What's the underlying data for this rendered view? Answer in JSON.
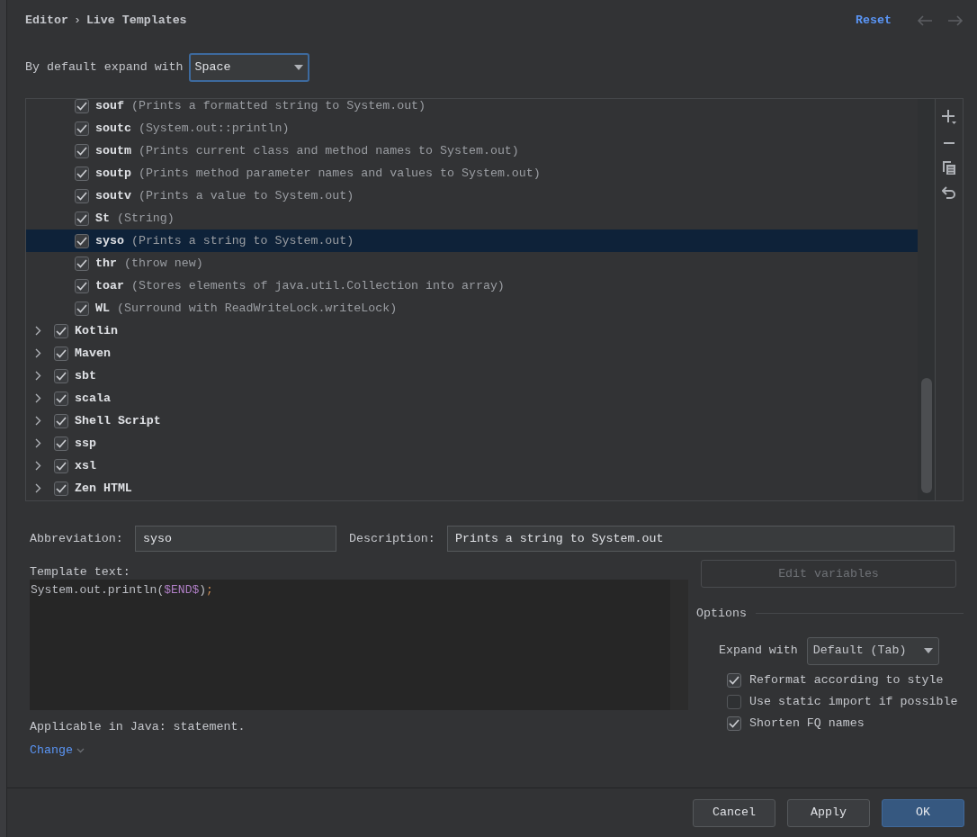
{
  "header": {
    "breadcrumb": [
      "Editor",
      "Live Templates"
    ],
    "separator": "›",
    "reset": "Reset"
  },
  "expand_default": {
    "label": "By default expand with",
    "value": "Space"
  },
  "tree": {
    "scrolled_group_children": [
      {
        "abbreviation": "souf",
        "description": "(Prints a formatted string to System.out)",
        "checked": true,
        "selected": false
      },
      {
        "abbreviation": "soutc",
        "description": "(System.out::println)",
        "checked": true,
        "selected": false
      },
      {
        "abbreviation": "soutm",
        "description": "(Prints current class and method names to System.out)",
        "checked": true,
        "selected": false
      },
      {
        "abbreviation": "soutp",
        "description": "(Prints method parameter names and values to System.out)",
        "checked": true,
        "selected": false
      },
      {
        "abbreviation": "soutv",
        "description": "(Prints a value to System.out)",
        "checked": true,
        "selected": false
      },
      {
        "abbreviation": "St",
        "description": "(String)",
        "checked": true,
        "selected": false
      },
      {
        "abbreviation": "syso",
        "description": "(Prints a string to System.out)",
        "checked": true,
        "selected": true
      },
      {
        "abbreviation": "thr",
        "description": "(throw new)",
        "checked": true,
        "selected": false
      },
      {
        "abbreviation": "toar",
        "description": "(Stores elements of java.util.Collection into array)",
        "checked": true,
        "selected": false
      },
      {
        "abbreviation": "WL",
        "description": "(Surround with ReadWriteLock.writeLock)",
        "checked": true,
        "selected": false
      }
    ],
    "groups": [
      {
        "name": "Kotlin",
        "checked": true,
        "expanded": false,
        "selected": false
      },
      {
        "name": "Maven",
        "checked": true,
        "expanded": false,
        "selected": false
      },
      {
        "name": "sbt",
        "checked": true,
        "expanded": false,
        "selected": false
      },
      {
        "name": "scala",
        "checked": true,
        "expanded": false,
        "selected": false
      },
      {
        "name": "Shell Script",
        "checked": true,
        "expanded": false,
        "selected": false
      },
      {
        "name": "ssp",
        "checked": true,
        "expanded": false,
        "selected": false
      },
      {
        "name": "xsl",
        "checked": true,
        "expanded": false,
        "selected": false
      },
      {
        "name": "Zen HTML",
        "checked": true,
        "expanded": false,
        "selected": false
      }
    ]
  },
  "details": {
    "abbreviation_label": "Abbreviation:",
    "abbreviation": "syso",
    "description_label": "Description:",
    "description": "Prints a string to System.out",
    "template_label": "Template text:",
    "template_tokens": [
      {
        "kind": "plain",
        "text": "System.out.println("
      },
      {
        "kind": "variable",
        "text": "$END$"
      },
      {
        "kind": "plain",
        "text": ")"
      },
      {
        "kind": "punctuation",
        "text": ";"
      }
    ],
    "applicable": "Applicable in Java: statement.",
    "change_link": "Change"
  },
  "options": {
    "edit_variables": "Edit variables",
    "edit_variables_disabled": true,
    "title": "Options",
    "expand_label": "Expand with",
    "expand_value": "Default (Tab)",
    "checkboxes": [
      {
        "label": "Reformat according to style",
        "checked": true
      },
      {
        "label": "Use static import if possible",
        "checked": false
      },
      {
        "label": "Shorten FQ names",
        "checked": true
      }
    ]
  },
  "buttons": [
    {
      "label": "Cancel",
      "kind": "default"
    },
    {
      "label": "Apply",
      "kind": "default"
    },
    {
      "label": "OK",
      "kind": "primary"
    }
  ]
}
